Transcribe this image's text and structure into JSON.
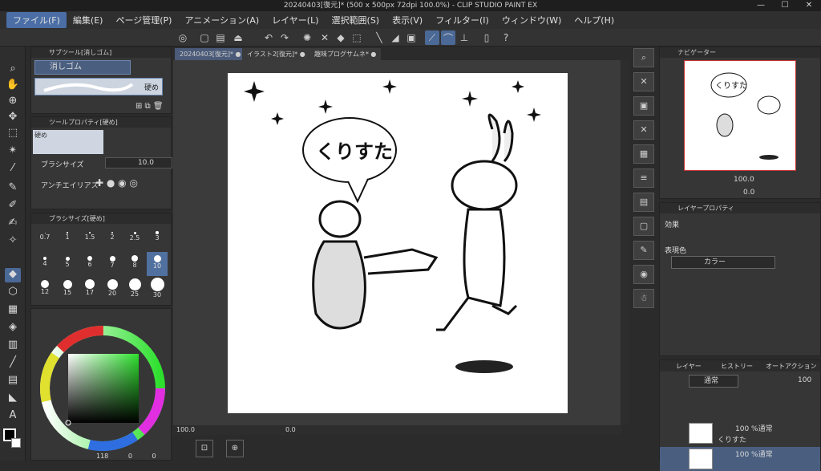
{
  "window": {
    "title": "20240403[復元]* (500 x 500px 72dpi 100.0%) - CLIP STUDIO PAINT EX"
  },
  "menu": [
    "ファイル(F)",
    "編集(E)",
    "ページ管理(P)",
    "アニメーション(A)",
    "レイヤー(L)",
    "選択範囲(S)",
    "表示(V)",
    "フィルター(I)",
    "ウィンドウ(W)",
    "ヘルプ(H)"
  ],
  "tabs": [
    "20240403[復元]*",
    "イラスト2[復元]*",
    "趣味プログサムネ*"
  ],
  "subtool": {
    "header": "サブツール[消しゴム]",
    "item": "消しゴム",
    "variant": "硬め"
  },
  "toolprop": {
    "header": "ツールプロパティ[硬め]",
    "preset": "硬め",
    "brush_size_label": "ブラシサイズ",
    "brush_size_value": "10.0",
    "aa_label": "アンチエイリアス"
  },
  "brushsize": {
    "header": "ブラシサイズ[硬め]",
    "sizes": [
      "0.7",
      "1",
      "1.5",
      "2",
      "2.5",
      "3",
      "4",
      "5",
      "6",
      "7",
      "8",
      "10",
      "12",
      "15",
      "17",
      "20",
      "25",
      "30"
    ]
  },
  "color": {
    "foreground": "#000000",
    "background": "#ffffff"
  },
  "statusbar": {
    "zoom": "100.0",
    "angle": "0.0",
    "bottom_left": "118",
    "bottom_mid": "0",
    "bottom_right": "0"
  },
  "canvas": {
    "speech_text": "くりすた"
  },
  "navigator": {
    "header": "ナビゲーター",
    "zoom": "100.0",
    "angle": "0.0"
  },
  "layerprop": {
    "header": "レイヤープロパティ",
    "effect_label": "効果",
    "expr_label": "表現色",
    "expr_value": "カラー"
  },
  "layers": {
    "tabs": [
      "レイヤー",
      "ヒストリー",
      "オートアクション"
    ],
    "blend": "通常",
    "opacity": "100",
    "items": [
      {
        "top": "100 %通常",
        "name": "くりすた"
      },
      {
        "top": "100 %通常",
        "name": ""
      }
    ]
  }
}
